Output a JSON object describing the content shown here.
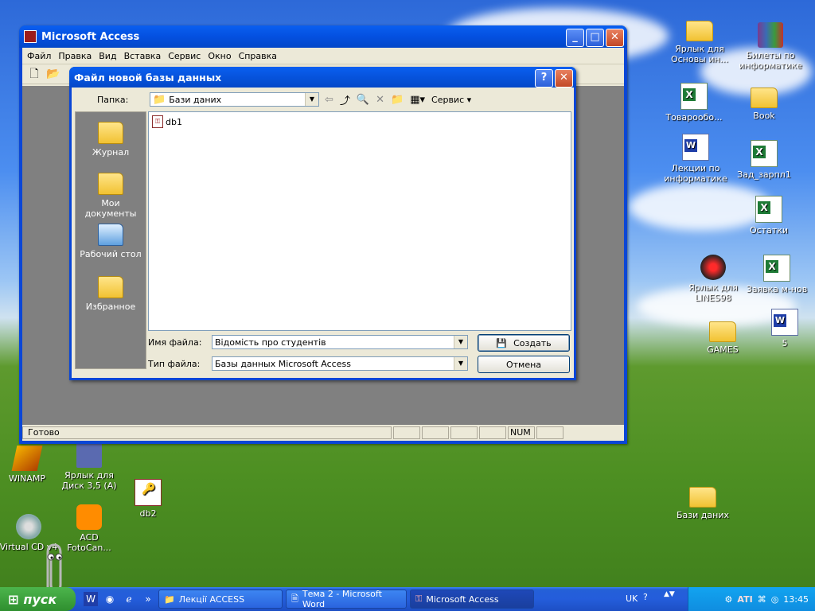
{
  "desktop": {
    "icons": [
      {
        "id": "shortcut-osnovy",
        "label": "Ярлык для Основы ин..."
      },
      {
        "id": "bilety",
        "label": "Билеты по информатике"
      },
      {
        "id": "tovaroobo",
        "label": "Товарообо..."
      },
      {
        "id": "book",
        "label": "Book"
      },
      {
        "id": "lekcii",
        "label": "Лекции по информатике"
      },
      {
        "id": "zad-zarpl",
        "label": "Зад_зарпл1"
      },
      {
        "id": "ostatki",
        "label": "Остатки"
      },
      {
        "id": "lines98",
        "label": "Ярлык для LINES98"
      },
      {
        "id": "zayavka",
        "label": "Заявка м-нов"
      },
      {
        "id": "games",
        "label": "GAMES"
      },
      {
        "id": "doc5",
        "label": "5"
      },
      {
        "id": "winamp",
        "label": "WINAMP"
      },
      {
        "id": "disk35",
        "label": "Ярлык для Диск 3,5 (A)"
      },
      {
        "id": "db2",
        "label": "db2"
      },
      {
        "id": "bazy-dannyh",
        "label": "Бази даних"
      },
      {
        "id": "virtualcd",
        "label": "Virtual CD v4"
      },
      {
        "id": "acd",
        "label": "ACD FotoCan..."
      }
    ]
  },
  "access_window": {
    "title": "Microsoft Access",
    "menu": [
      "Файл",
      "Правка",
      "Вид",
      "Вставка",
      "Сервис",
      "Окно",
      "Справка"
    ],
    "status": "Готово",
    "status_num": "NUM"
  },
  "dialog": {
    "title": "Файл новой базы данных",
    "folder_label": "Папка:",
    "folder_value": "Бази даних",
    "service_label": "Сервис",
    "places": [
      "Журнал",
      "Мои документы",
      "Рабочий стол",
      "Избранное"
    ],
    "files": [
      "db1"
    ],
    "filename_label": "Имя файла:",
    "filename_value": "Відомість про студентів",
    "filetype_label": "Тип файла:",
    "filetype_value": "Базы данных Microsoft Access",
    "create_label": "Создать",
    "cancel_label": "Отмена",
    "help_glyph": "?",
    "close_glyph": "✕"
  },
  "taskbar": {
    "start_label": "пуск",
    "tasks": [
      {
        "label": "Лекції ACCESS",
        "icon": "folder-icon",
        "active": false
      },
      {
        "label": "Тема 2 - Microsoft Word",
        "icon": "word-icon",
        "active": false
      },
      {
        "label": "Microsoft Access",
        "icon": "access-icon",
        "active": true
      }
    ],
    "language": "UK",
    "clock": "13:45"
  }
}
